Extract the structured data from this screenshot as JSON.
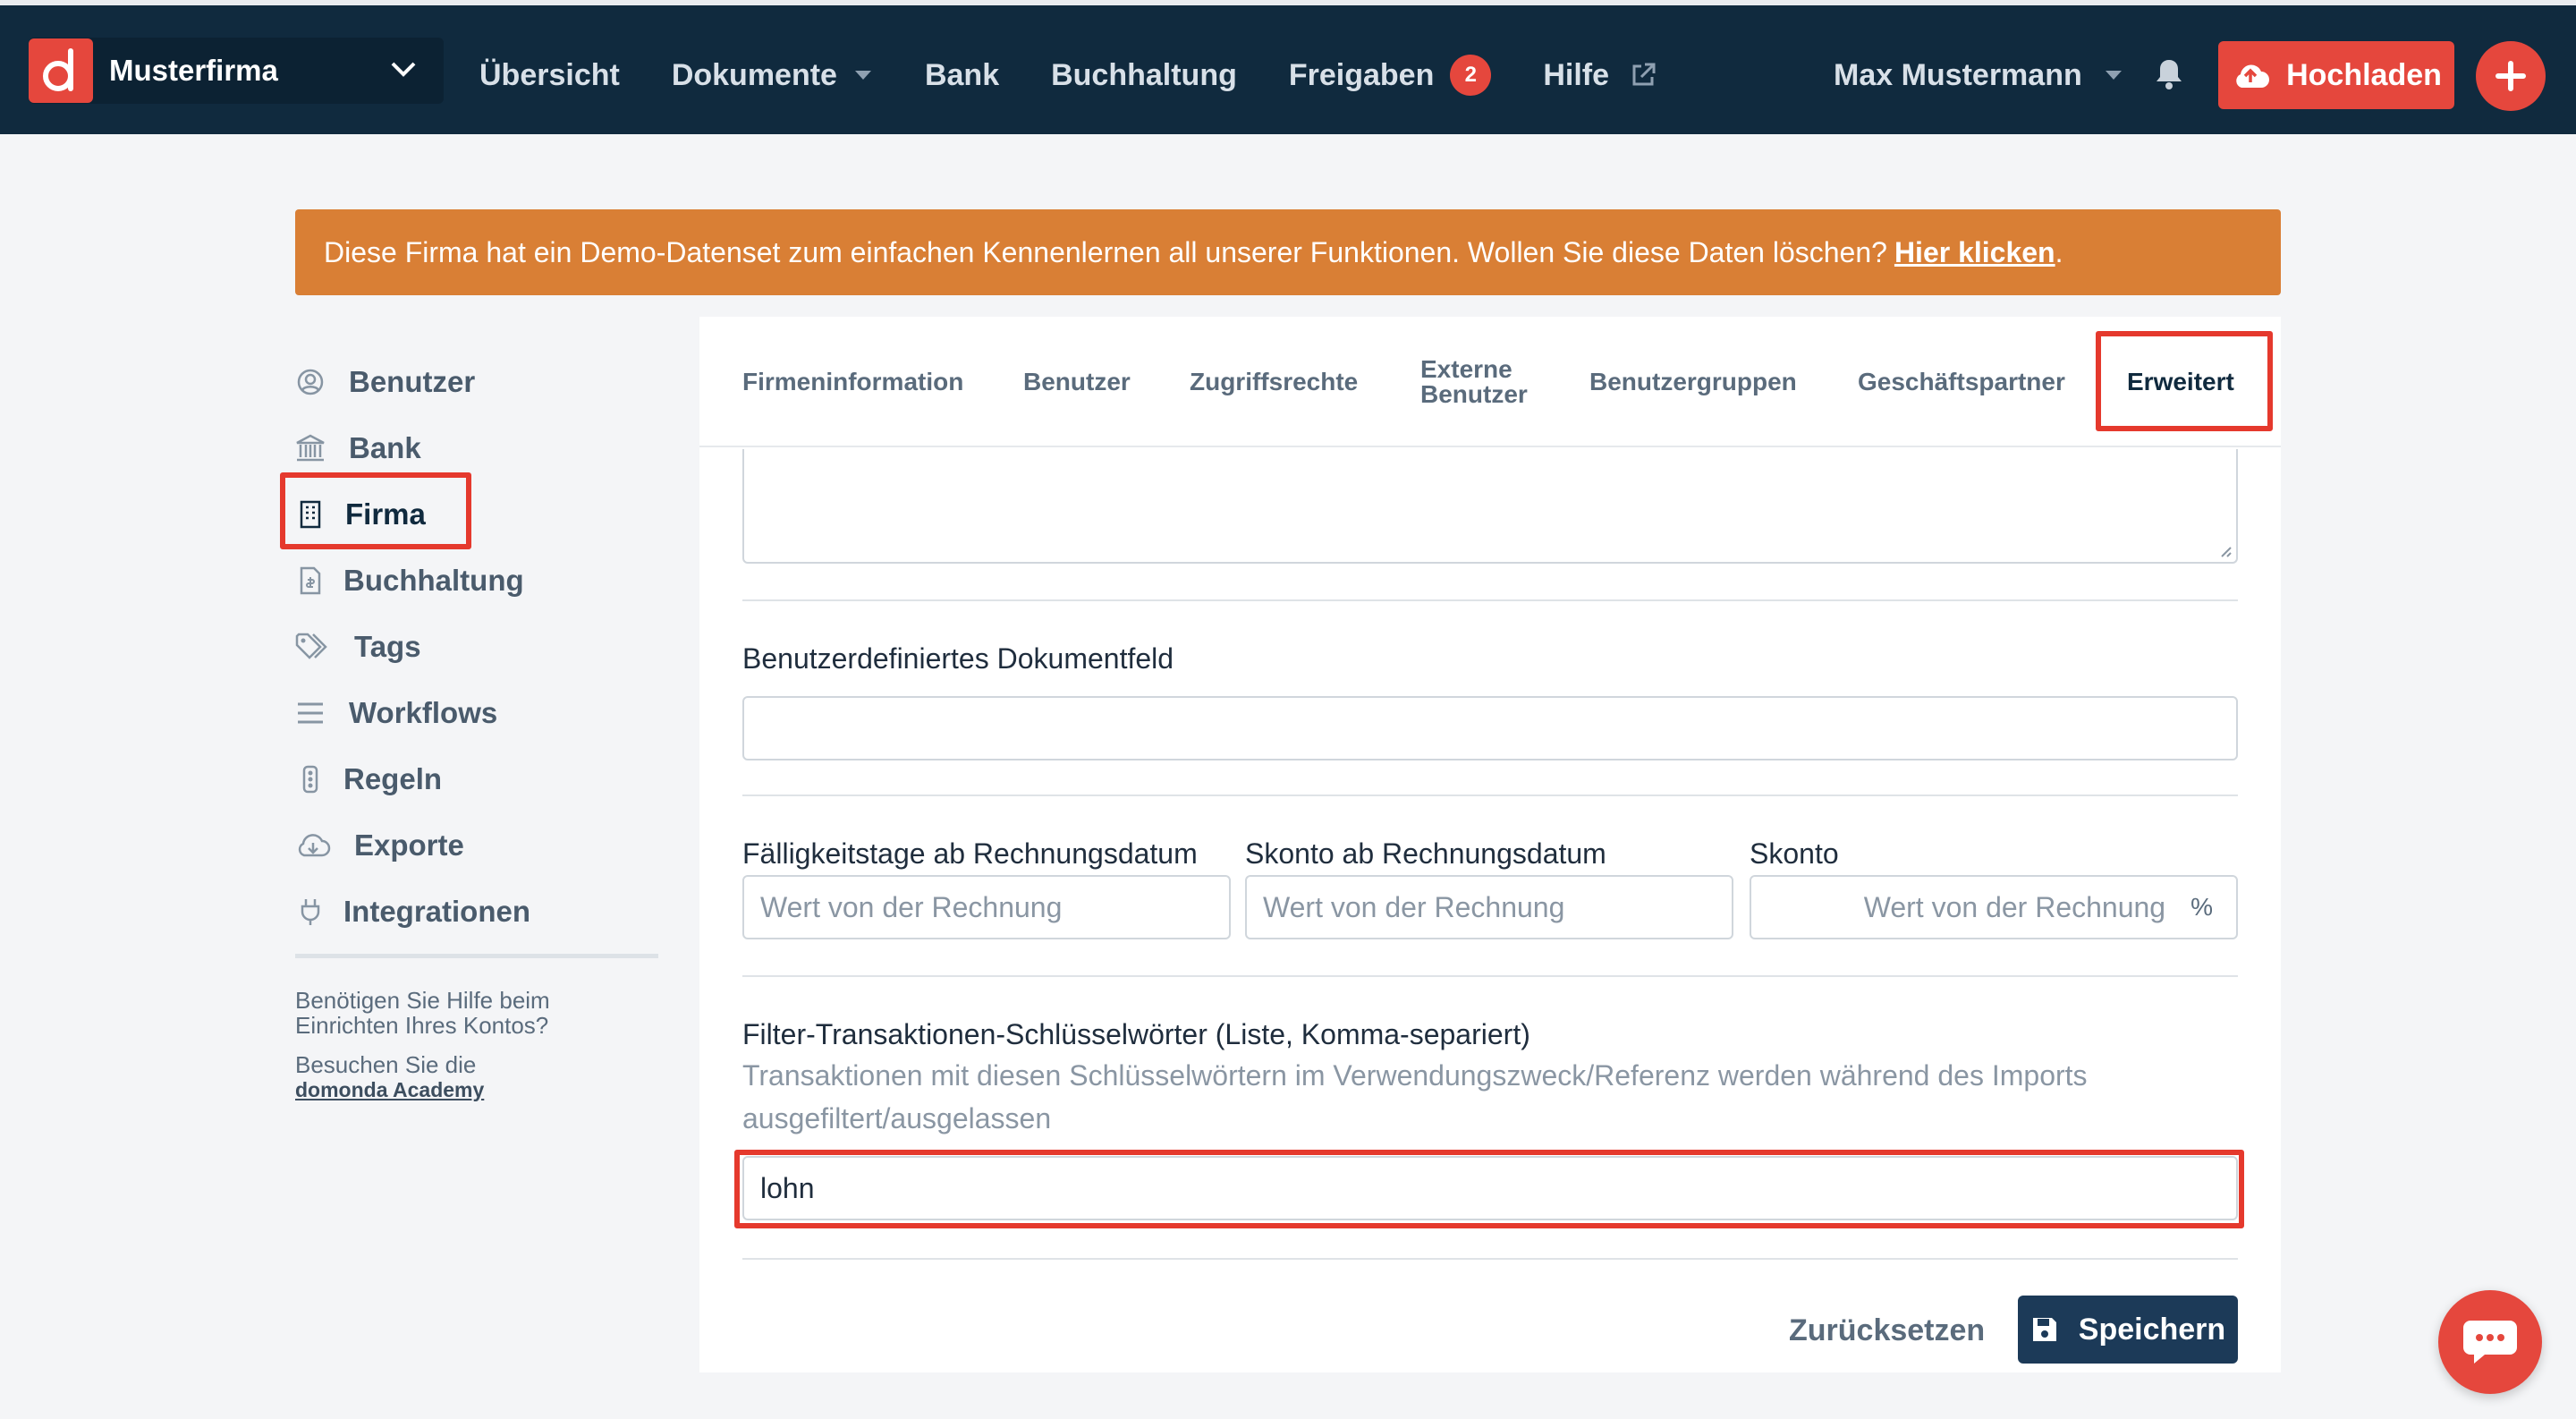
{
  "colors": {
    "nav_bg": "#102a3e",
    "accent": "#e5473d",
    "banner": "#d97f35",
    "highlight": "#e5392d",
    "save_btn": "#1c3a58"
  },
  "header": {
    "company": "Musterfirma",
    "nav": [
      {
        "label": "Übersicht"
      },
      {
        "label": "Dokumente",
        "dropdown": true
      },
      {
        "label": "Bank"
      },
      {
        "label": "Buchhaltung"
      },
      {
        "label": "Freigaben",
        "badge": "2"
      },
      {
        "label": "Hilfe",
        "external": true
      }
    ],
    "user": "Max Mustermann",
    "upload_label": "Hochladen"
  },
  "banner": {
    "text": "Diese Firma hat ein Demo-Datenset zum einfachen Kennenlernen all unserer Funktionen. Wollen Sie diese Daten löschen?",
    "link": "Hier klicken",
    "suffix": "."
  },
  "sidebar": {
    "items": [
      {
        "label": "Benutzer",
        "icon": "user-circle-icon"
      },
      {
        "label": "Bank",
        "icon": "bank-icon"
      },
      {
        "label": "Firma",
        "icon": "building-icon",
        "active": true
      },
      {
        "label": "Buchhaltung",
        "icon": "receipt-icon"
      },
      {
        "label": "Tags",
        "icon": "tags-icon"
      },
      {
        "label": "Workflows",
        "icon": "list-icon"
      },
      {
        "label": "Regeln",
        "icon": "traffic-light-icon"
      },
      {
        "label": "Exporte",
        "icon": "cloud-download-icon"
      },
      {
        "label": "Integrationen",
        "icon": "plug-icon"
      }
    ],
    "help_line1": "Benötigen Sie Hilfe beim",
    "help_line2": "Einrichten Ihres Kontos?",
    "help_line3": "Besuchen Sie die",
    "help_link": "domonda Academy"
  },
  "tabs": [
    {
      "label": "Firmeninformation"
    },
    {
      "label": "Benutzer"
    },
    {
      "label": "Zugriffsrechte"
    },
    {
      "label_line1": "Externe",
      "label_line2": "Benutzer"
    },
    {
      "label": "Benutzergruppen"
    },
    {
      "label": "Geschäftspartner"
    },
    {
      "label": "Erweitert",
      "active": true
    }
  ],
  "form": {
    "custom_field_label": "Benutzerdefiniertes Dokumentfeld",
    "custom_field_value": "",
    "due_days_label": "Fälligkeitstage ab Rechnungsdatum",
    "due_days_placeholder": "Wert von der Rechnung",
    "skonto_days_label": "Skonto ab Rechnungsdatum",
    "skonto_days_placeholder": "Wert von der Rechnung",
    "skonto_label": "Skonto",
    "skonto_placeholder": "Wert von der Rechnung",
    "skonto_unit": "%",
    "filter_label": "Filter-Transaktionen-Schlüsselwörter (Liste, Komma-separiert)",
    "filter_desc": "Transaktionen mit diesen Schlüsselwörtern im Verwendungszweck/Referenz werden während des Imports ausgefiltert/ausgelassen",
    "filter_value": "lohn",
    "reset_label": "Zurücksetzen",
    "save_label": "Speichern"
  }
}
